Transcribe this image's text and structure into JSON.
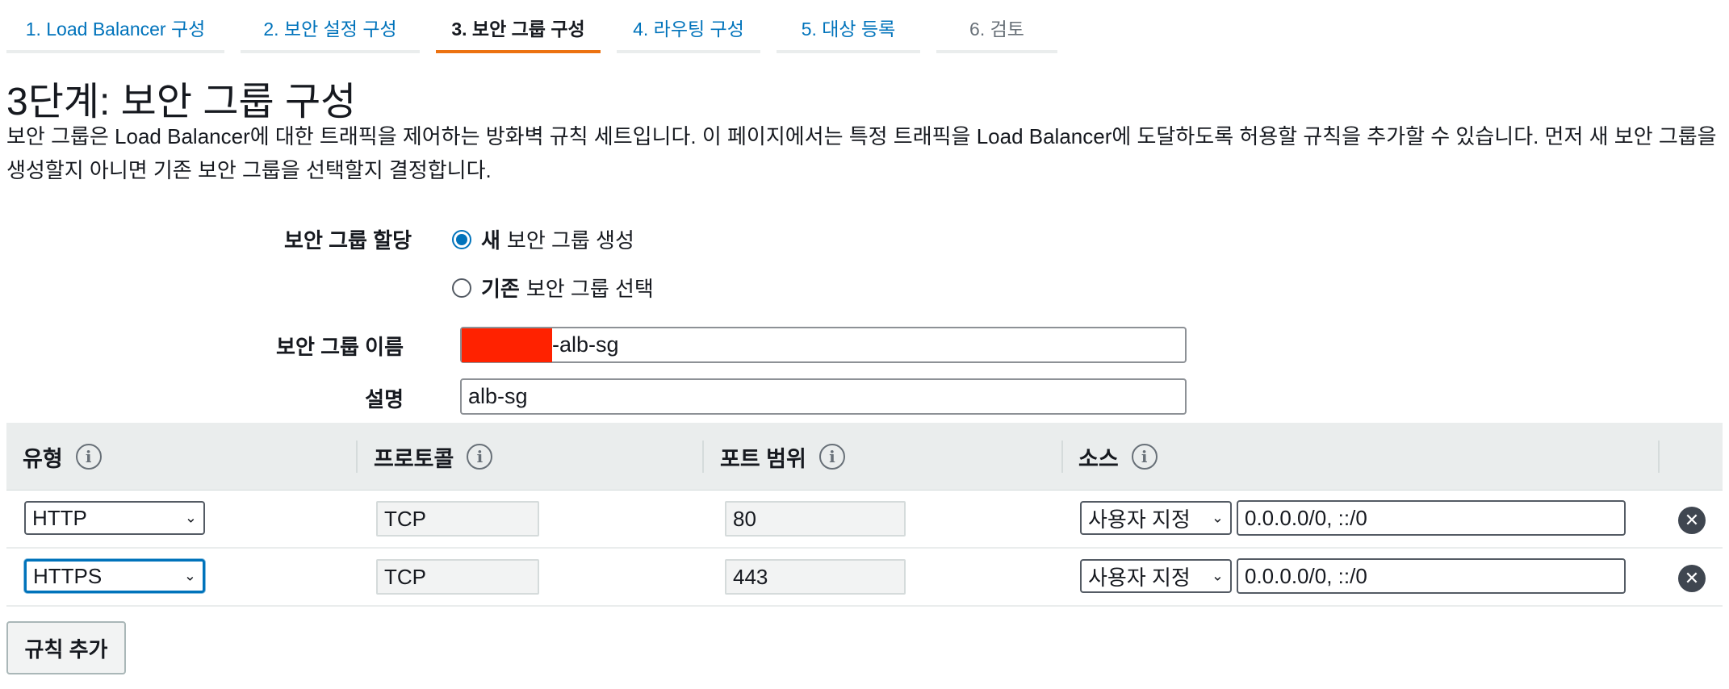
{
  "tabs": [
    {
      "label": "1. Load Balancer 구성",
      "state": "link"
    },
    {
      "label": "2. 보안 설정 구성",
      "state": "link"
    },
    {
      "label": "3. 보안 그룹 구성",
      "state": "active"
    },
    {
      "label": "4. 라우팅 구성",
      "state": "link"
    },
    {
      "label": "5. 대상 등록",
      "state": "link"
    },
    {
      "label": "6. 검토",
      "state": "disabled"
    }
  ],
  "page": {
    "title": "3단계: 보안 그룹 구성",
    "description": "보안 그룹은 Load Balancer에 대한 트래픽을 제어하는 방화벽 규칙 세트입니다. 이 페이지에서는 특정 트래픽을 Load Balancer에 도달하도록 허용할 규칙을 추가할 수 있습니다. 먼저 새 보안 그룹을 생성할지 아니면 기존 보안 그룹을 선택할지 결정합니다."
  },
  "form": {
    "assign_label": "보안 그룹 할당",
    "option_new_bold": "새",
    "option_new_rest": "보안 그룹 생성",
    "option_existing_bold": "기존",
    "option_existing_rest": "보안 그룹 선택",
    "selected_option": "new",
    "name_label": "보안 그룹 이름",
    "name_suffix": "-alb-sg",
    "desc_label": "설명",
    "desc_value": "alb-sg"
  },
  "rules_table": {
    "headers": {
      "type": "유형",
      "protocol": "프로토콜",
      "port": "포트 범위",
      "source": "소스"
    },
    "info_glyph": "i",
    "rows": [
      {
        "type": "HTTP",
        "protocol": "TCP",
        "port": "80",
        "source_mode": "사용자 지정",
        "cidr": "0.0.0.0/0, ::/0"
      },
      {
        "type": "HTTPS",
        "protocol": "TCP",
        "port": "443",
        "source_mode": "사용자 지정",
        "cidr": "0.0.0.0/0, ::/0"
      }
    ]
  },
  "add_rule_label": "규칙 추가",
  "icons": {
    "chevron": "chevron-down-icon",
    "remove": "remove-circle-icon",
    "info": "info-icon"
  },
  "colors": {
    "link": "#0073bb",
    "active_tab_underline": "#ec7211",
    "redaction": "#ff2200"
  }
}
